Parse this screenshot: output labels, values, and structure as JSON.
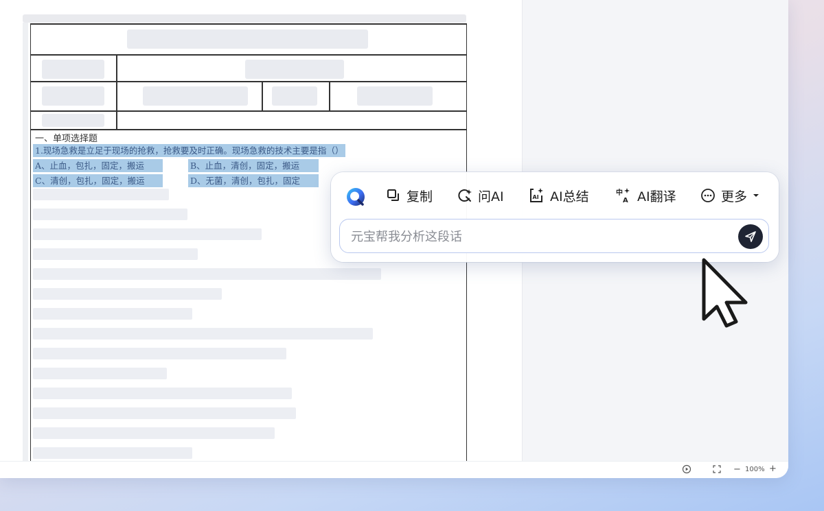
{
  "document": {
    "section_title": "一、单项选择题",
    "question": "1.现场急救是立足于现场的抢救，抢救要及时正确。现场急救的技术主要是指（）",
    "options": {
      "a": "A、止血，包扎，固定，搬运",
      "b": "B、止血，清创，固定，搬运",
      "c": "C、清创，包扎，固定，搬运",
      "d": "D、无菌，清创，包扎，固定"
    }
  },
  "popup": {
    "tools": {
      "copy": "复制",
      "ask_ai": "问AI",
      "summarize": "AI总结",
      "translate": "AI翻译",
      "more": "更多"
    },
    "input": {
      "placeholder": "元宝帮我分析这段话",
      "value": ""
    }
  },
  "status_bar": {
    "zoom": "100%",
    "zoom_minus": "−",
    "zoom_plus": "+"
  },
  "colors": {
    "highlight": "#a9cbe7",
    "accent": "#3d6df2",
    "send_button": "#1f2433"
  },
  "icons": [
    "yuanbao-logo-icon",
    "copy-icon",
    "ask-ai-icon",
    "ai-summary-icon",
    "ai-translate-icon",
    "more-icon",
    "chevron-down-icon",
    "send-icon",
    "play-icon",
    "fit-screen-icon",
    "cursor-icon"
  ]
}
